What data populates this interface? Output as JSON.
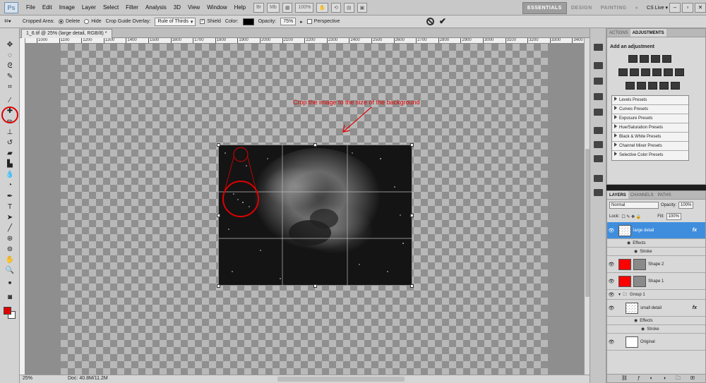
{
  "app": {
    "logo": "Ps"
  },
  "menu": [
    "File",
    "Edit",
    "Image",
    "Layer",
    "Select",
    "Filter",
    "Analysis",
    "3D",
    "View",
    "Window",
    "Help"
  ],
  "menu_controls": {
    "zoom": "100%"
  },
  "workspaces": {
    "essentials": "ESSENTIALS",
    "design": "DESIGN",
    "painting": "PAINTING",
    "more": "»",
    "cslive": "CS Live ▾"
  },
  "options": {
    "cropped_area_label": "Cropped Area:",
    "delete_label": "Delete",
    "hide_label": "Hide",
    "guide_overlay_label": "Crop Guide Overlay:",
    "guide_overlay_value": "Rule of Thirds",
    "shield_label": "Shield",
    "color_label": "Color:",
    "opacity_label": "Opacity:",
    "opacity_value": "75%",
    "perspective_label": "Perspective"
  },
  "document": {
    "tab_title": "1_6.tif @ 25% (large detail, RGB/8) *",
    "ruler_ticks": [
      "1000",
      "1100",
      "1200",
      "1300",
      "1400",
      "1500",
      "1600",
      "1700",
      "1800",
      "1900",
      "2000",
      "2100",
      "2200",
      "2300",
      "2400",
      "2500",
      "2600",
      "2700",
      "2800",
      "2900",
      "3000",
      "3100",
      "3200",
      "3300",
      "3400"
    ],
    "annotation": "Crop the image to the size of the background"
  },
  "status": {
    "zoom": "25%",
    "doc": "Doc: 40.8M/11.2M"
  },
  "adjustments_panel": {
    "tabs": [
      "ACTIONS",
      "ADJUSTMENTS"
    ],
    "title": "Add an adjustment",
    "presets": [
      "Levels Presets",
      "Curves Presets",
      "Exposure Presets",
      "Hue/Saturation Presets",
      "Black & White Presets",
      "Channel Mixer Presets",
      "Selective Color Presets"
    ]
  },
  "layers_panel": {
    "tabs": [
      "LAYERS",
      "CHANNELS",
      "PATHS"
    ],
    "blend_mode": "Normal",
    "opacity_label": "Opacity:",
    "opacity_value": "100%",
    "lock_label": "Lock:",
    "fill_label": "Fill:",
    "fill_value": "100%",
    "layers": {
      "large_detail": "large detail",
      "effects": "Effects",
      "stroke": "Stroke",
      "shape2": "Shape 2",
      "shape1": "Shape 1",
      "group1": "Group 1",
      "small_detail": "small detail",
      "effects2": "Effects",
      "stroke2": "Stroke",
      "original": "Original"
    },
    "fx": "fx"
  },
  "colors": {
    "foreground": "#e00000",
    "background": "#ffffff",
    "annotation": "#e00000",
    "selected_layer": "#3f8ede"
  }
}
